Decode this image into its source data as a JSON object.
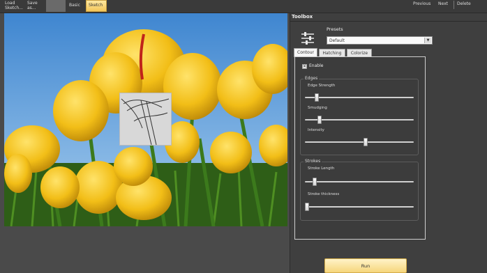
{
  "toolbar": {
    "buttons": [
      {
        "label": "Load",
        "sub": "Sketch..."
      },
      {
        "label": "Save",
        "sub": "as..."
      },
      {
        "label": "",
        "sub": ""
      },
      {
        "label": "Basic",
        "sub": ""
      },
      {
        "label": "Sketch",
        "sub": ""
      }
    ],
    "nav": {
      "previous": "Previous",
      "next": "Next",
      "delete": "Delete"
    }
  },
  "toolbox": {
    "title": "Toolbox",
    "presets_label": "Presets",
    "presets_value": "Default",
    "tabs": [
      "Contour",
      "Hatching",
      "Colorize"
    ],
    "enable_label": "Enable",
    "enable_checked": true,
    "edges": {
      "title": "Edges",
      "sliders": [
        {
          "label": "Edge Strength",
          "value": 0.09
        },
        {
          "label": "Smudging",
          "value": 0.12
        },
        {
          "label": "Intensity",
          "value": 0.56
        }
      ]
    },
    "strokes": {
      "title": "Strokes",
      "sliders": [
        {
          "label": "Stroke Length",
          "value": 0.07
        },
        {
          "label": "Stroke thickness",
          "value": 0.0
        }
      ]
    },
    "run_label": "Run"
  },
  "colors": {
    "sky": "#4d8fd1",
    "tulip": "#f2c21a",
    "stem": "#3c7a1c",
    "accent_button": "#f6d67c"
  }
}
